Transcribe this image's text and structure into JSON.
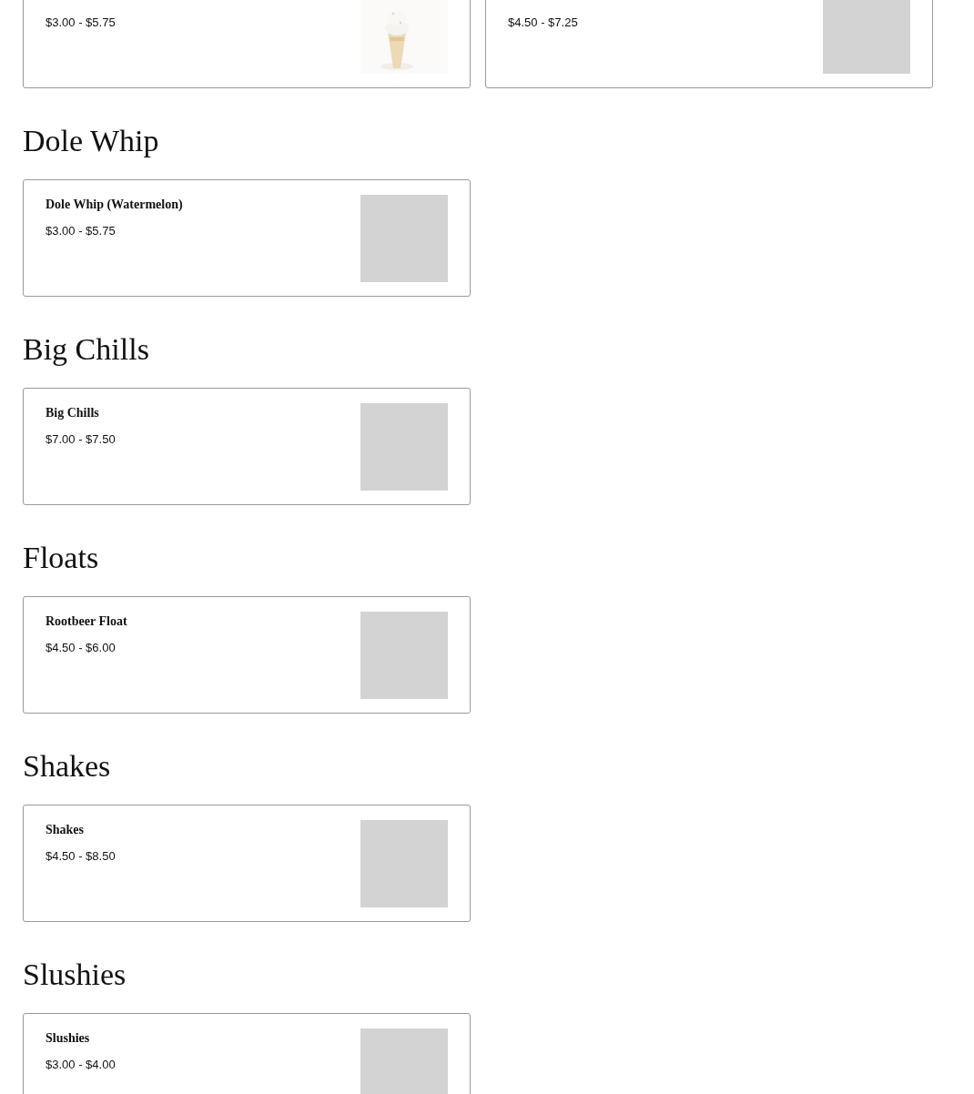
{
  "sections": [
    {
      "items": [
        {
          "price": "$3.00 - $5.75"
        },
        {
          "price": "$4.50 - $7.25",
          "kind": "placeholder"
        }
      ]
    },
    {
      "title": "Dole Whip",
      "items": [
        {
          "name": "Dole Whip (Watermelon)",
          "price": "$3.00 - $5.75",
          "kind": "placeholder"
        }
      ]
    },
    {
      "title": "Big Chills",
      "items": [
        {
          "name": "Big Chills",
          "price": "$7.00 - $7.50",
          "kind": "placeholder"
        }
      ]
    },
    {
      "title": "Floats",
      "items": [
        {
          "name": "Rootbeer Float",
          "price": "$4.50 - $6.00",
          "kind": "placeholder"
        }
      ]
    },
    {
      "title": "Shakes",
      "items": [
        {
          "name": "Shakes",
          "price": "$4.50 - $8.50",
          "kind": "placeholder"
        }
      ]
    },
    {
      "title": "Slushies",
      "items": [
        {
          "name": "Slushies",
          "price": "$3.00 - $4.00",
          "kind": "placeholder"
        }
      ]
    }
  ]
}
